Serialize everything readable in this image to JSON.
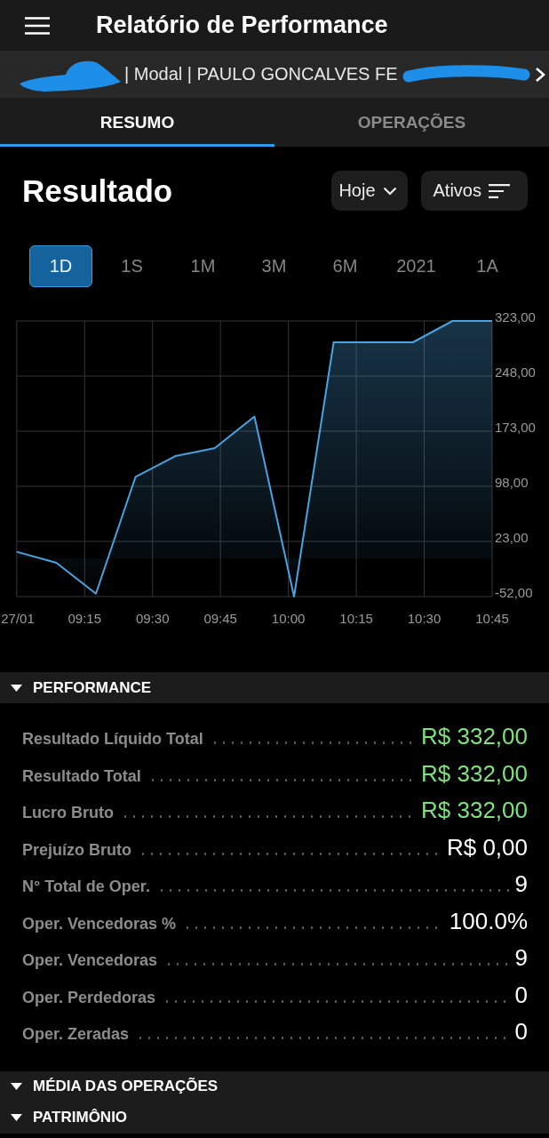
{
  "app_bar": {
    "title": "Relatório de Performance"
  },
  "account": {
    "text": "| Modal | PAULO GONCALVES FE"
  },
  "tabs": [
    {
      "label": "RESUMO",
      "selected": true
    },
    {
      "label": "OPERAÇÕES",
      "selected": false
    }
  ],
  "result": {
    "title": "Resultado",
    "buttons": [
      {
        "label": "Hoje",
        "kind": "dropdown"
      },
      {
        "label": "Ativos",
        "kind": "filter"
      }
    ],
    "periods": [
      {
        "label": "1D",
        "selected": true
      },
      {
        "label": "1S",
        "selected": false
      },
      {
        "label": "1M",
        "selected": false
      },
      {
        "label": "3M",
        "selected": false
      },
      {
        "label": "6M",
        "selected": false
      },
      {
        "label": "2021",
        "selected": false
      },
      {
        "label": "1A",
        "selected": false
      }
    ],
    "chart_data": {
      "type": "area",
      "grid": true,
      "x": [
        9,
        9.1458,
        9.2917,
        9.4375,
        9.5833,
        9.7292,
        9.875,
        10.0208,
        10.1667,
        10.3125,
        10.4583,
        10.6042,
        10.75
      ],
      "series": [
        {
          "color": "#4aa3e0",
          "values": [
            9,
            -6,
            -48,
            111,
            139,
            150,
            193,
            -52,
            294,
            294,
            294,
            323,
            323
          ]
        }
      ],
      "xlim": [
        9,
        10.75
      ],
      "ylim": [
        -52,
        323
      ],
      "xticks": [
        {
          "value": 9,
          "label": "27/01"
        },
        {
          "value": 9.25,
          "label": "09:15"
        },
        {
          "value": 9.5,
          "label": "09:30"
        },
        {
          "value": 9.75,
          "label": "09:45"
        },
        {
          "value": 10,
          "label": "10:00"
        },
        {
          "value": 10.25,
          "label": "10:15"
        },
        {
          "value": 10.5,
          "label": "10:30"
        },
        {
          "value": 10.75,
          "label": "10:45"
        }
      ],
      "yticks": [
        {
          "value": 323,
          "label": "323,00"
        },
        {
          "value": 248,
          "label": "248,00"
        },
        {
          "value": 173,
          "label": "173,00"
        },
        {
          "value": 98,
          "label": "98,00"
        },
        {
          "value": 23,
          "label": "23,00"
        },
        {
          "value": -52,
          "label": "-52,00"
        }
      ]
    }
  },
  "sections": [
    {
      "title": "PERFORMANCE",
      "rows": [
        {
          "label": "Resultado Líquido Total",
          "value": "R$ 332,00",
          "color": "#7fe07f"
        },
        {
          "label": "Resultado Total",
          "value": "R$ 332,00",
          "color": "#7fe07f"
        },
        {
          "label": "Lucro Bruto",
          "value": "R$ 332,00",
          "color": "#7fe07f"
        },
        {
          "label": "Prejuízo Bruto",
          "value": "R$ 0,00",
          "color": "#ffffff"
        },
        {
          "label": "N° Total de Oper.",
          "value": "9",
          "color": "#ffffff"
        },
        {
          "label": "Oper. Vencedoras %",
          "value": "100.0%",
          "color": "#ffffff"
        },
        {
          "label": "Oper. Vencedoras",
          "value": "9",
          "color": "#ffffff"
        },
        {
          "label": "Oper. Perdedoras",
          "value": "0",
          "color": "#ffffff"
        },
        {
          "label": "Oper. Zeradas",
          "value": "0",
          "color": "#ffffff"
        }
      ]
    },
    {
      "title": "MÉDIA DAS OPERAÇÕES"
    },
    {
      "title": "PATRIMÔNIO"
    }
  ]
}
